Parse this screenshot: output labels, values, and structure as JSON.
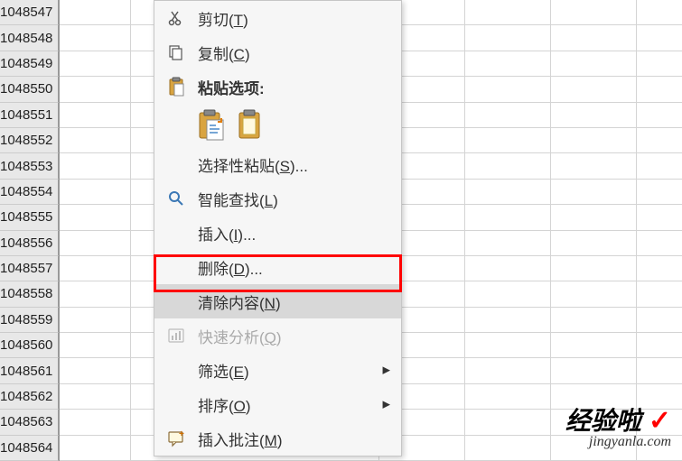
{
  "row_headers": [
    "1048547",
    "1048548",
    "1048549",
    "1048550",
    "1048551",
    "1048552",
    "1048553",
    "1048554",
    "1048555",
    "1048556",
    "1048557",
    "1048558",
    "1048559",
    "1048560",
    "1048561",
    "1048562",
    "1048563",
    "1048564"
  ],
  "menu": {
    "cut": {
      "label": "剪切(",
      "accel": "T",
      "suffix": ")"
    },
    "copy": {
      "label": "复制(",
      "accel": "C",
      "suffix": ")"
    },
    "paste_options": {
      "label": "粘贴选项:"
    },
    "paste_special": {
      "label": "选择性粘贴(",
      "accel": "S",
      "suffix": ")..."
    },
    "smart_lookup": {
      "label": "智能查找(",
      "accel": "L",
      "suffix": ")"
    },
    "insert": {
      "label": "插入(",
      "accel": "I",
      "suffix": ")..."
    },
    "delete": {
      "label": "删除(",
      "accel": "D",
      "suffix": ")..."
    },
    "clear_contents": {
      "label": "清除内容(",
      "accel": "N",
      "suffix": ")"
    },
    "quick_analysis": {
      "label": "快速分析(",
      "accel": "Q",
      "suffix": ")"
    },
    "filter": {
      "label": "筛选(",
      "accel": "E",
      "suffix": ")"
    },
    "sort": {
      "label": "排序(",
      "accel": "O",
      "suffix": ")"
    },
    "insert_comment": {
      "label": "插入批注(",
      "accel": "M",
      "suffix": ")"
    }
  },
  "watermark": {
    "main": "经验啦",
    "check": "✓",
    "sub": "jingyanla.com"
  },
  "icons": {
    "cut": "cut-icon",
    "copy": "copy-icon",
    "paste": "paste-icon",
    "clipboard1": "clipboard-paste-icon",
    "clipboard2": "clipboard-plain-icon",
    "search": "search-icon",
    "analysis": "analysis-icon",
    "comment": "comment-icon",
    "submenu": "chevron-right-icon"
  }
}
